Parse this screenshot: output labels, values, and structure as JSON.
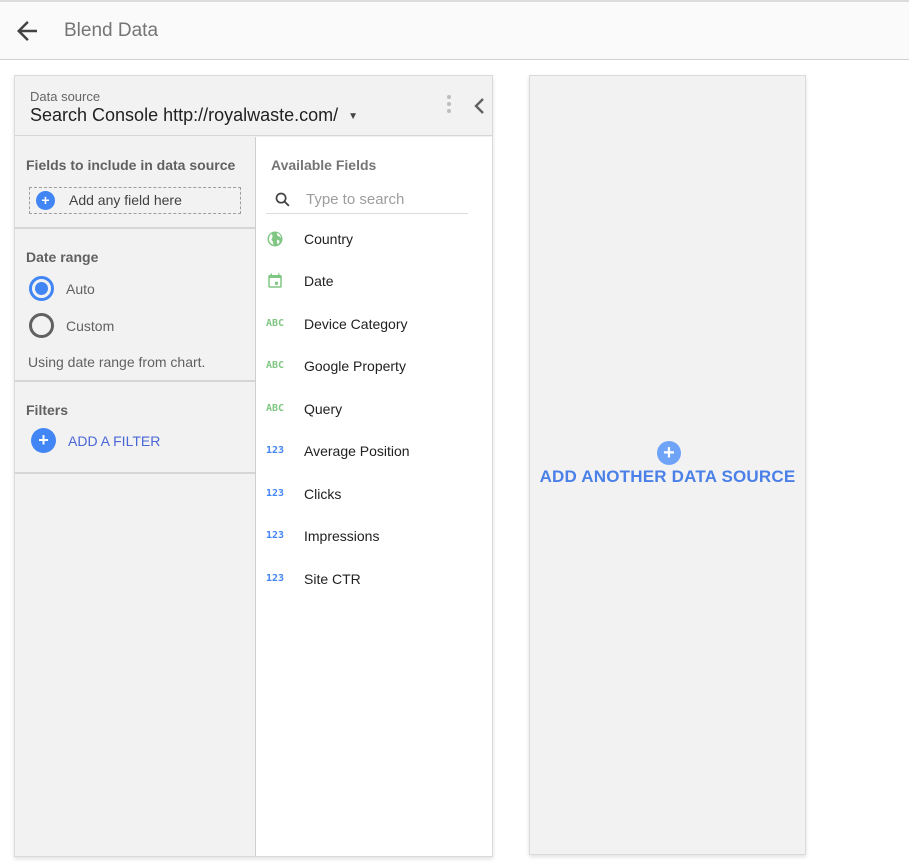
{
  "header": {
    "back_icon": "arrow-left-icon",
    "title": "Blend Data"
  },
  "data_source_panel": {
    "label": "Data source",
    "selected": "Search Console http://royalwaste.com/",
    "dropdown_icon": "caret-down-icon",
    "menu_icon": "more-vert-icon",
    "collapse_icon": "chevron-left-icon",
    "fields_section": {
      "title": "Fields to include in data source",
      "add_field_label": "Add any field here",
      "add_icon": "plus-circle-icon"
    },
    "date_range": {
      "title": "Date range",
      "options": [
        {
          "label": "Auto",
          "checked": true
        },
        {
          "label": "Custom",
          "checked": false
        }
      ],
      "hint": "Using date range from chart."
    },
    "filters": {
      "title": "Filters",
      "add_filter_label": "ADD A FILTER",
      "add_icon": "plus-circle-icon"
    },
    "available_fields": {
      "title": "Available Fields",
      "search_placeholder": "Type to search",
      "search_value": "",
      "search_icon": "search-icon",
      "items": [
        {
          "icon": "globe-icon",
          "type": "geo",
          "label": "Country"
        },
        {
          "icon": "calendar-icon",
          "type": "date",
          "label": "Date"
        },
        {
          "icon": "abc-icon",
          "type": "text",
          "badge": "ABC",
          "label": "Device Category"
        },
        {
          "icon": "abc-icon",
          "type": "text",
          "badge": "ABC",
          "label": "Google Property"
        },
        {
          "icon": "abc-icon",
          "type": "text",
          "badge": "ABC",
          "label": "Query"
        },
        {
          "icon": "number-icon",
          "type": "number",
          "badge": "123",
          "label": "Average Position"
        },
        {
          "icon": "number-icon",
          "type": "number",
          "badge": "123",
          "label": "Clicks"
        },
        {
          "icon": "number-icon",
          "type": "number",
          "badge": "123",
          "label": "Impressions"
        },
        {
          "icon": "number-icon",
          "type": "number",
          "badge": "123",
          "label": "Site CTR"
        }
      ]
    }
  },
  "add_data_source": {
    "label": "ADD ANOTHER DATA SOURCE",
    "icon": "plus-circle-icon"
  },
  "colors": {
    "accent_blue": "#4285f4",
    "link_blue": "#4a67d6",
    "dimension_green": "#81c784",
    "panel_bg": "#f2f2f2"
  }
}
